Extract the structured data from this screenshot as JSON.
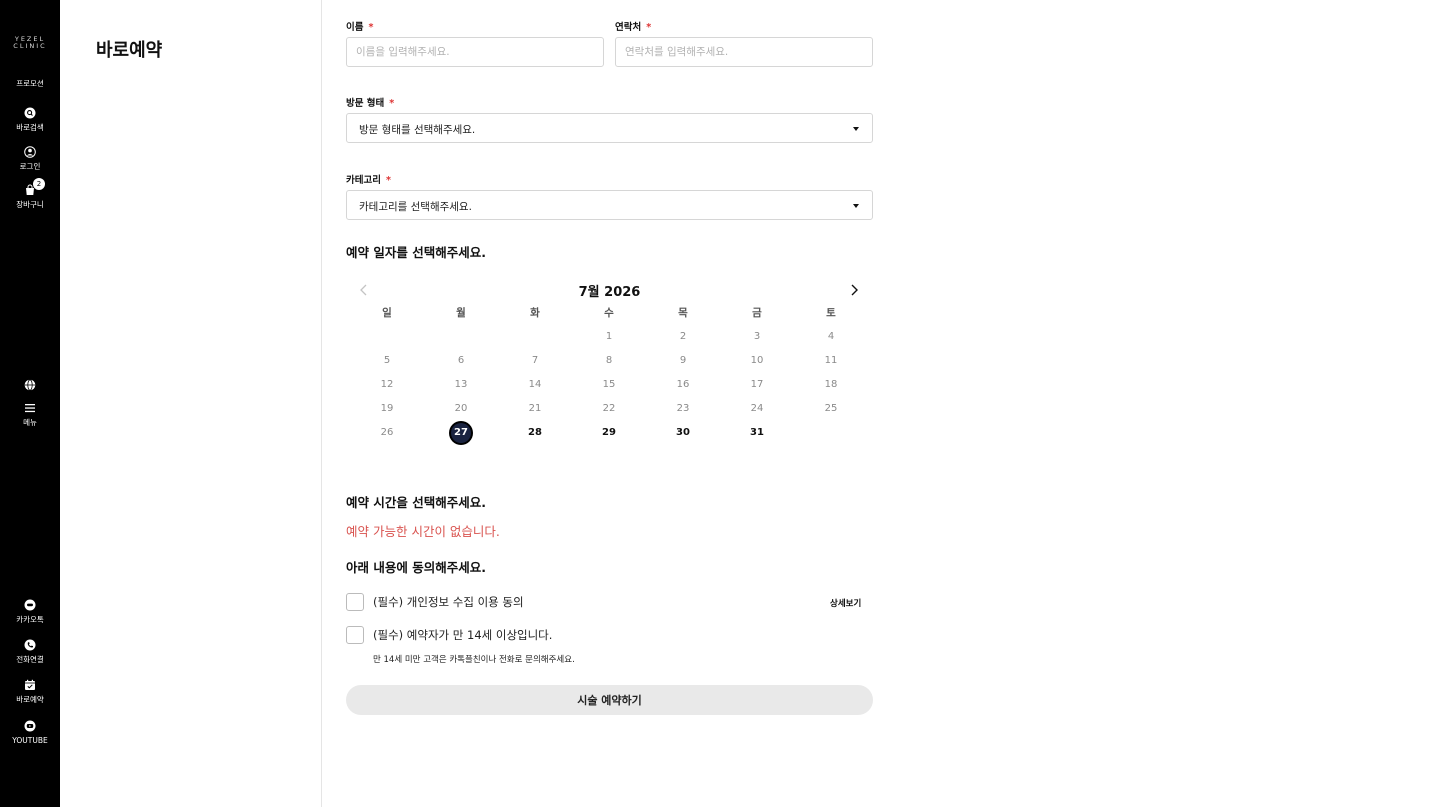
{
  "sidebar": {
    "logo_line1": "YEZEL",
    "logo_line2": "CLINIC",
    "items_top": [
      {
        "label": "프로모션",
        "icon": "none"
      },
      {
        "label": "바로검색",
        "icon": "search-icon"
      },
      {
        "label": "로그인",
        "icon": "user-icon"
      },
      {
        "label": "장바구니",
        "icon": "cart-icon",
        "badge": "2"
      }
    ],
    "items_mid": [
      {
        "label": "",
        "icon": "globe-icon"
      },
      {
        "label": "메뉴",
        "icon": "menu-icon"
      }
    ],
    "items_bottom": [
      {
        "label": "카카오톡",
        "icon": "kakaotalk-icon"
      },
      {
        "label": "전화연결",
        "icon": "phone-icon"
      },
      {
        "label": "바로예약",
        "icon": "calendar-check-icon"
      },
      {
        "label": "YOUTUBE",
        "icon": "youtube-icon"
      }
    ]
  },
  "page": {
    "title": "바로예약"
  },
  "form": {
    "name": {
      "label": "이름",
      "required": "*",
      "placeholder": "이름을 입력해주세요.",
      "value": ""
    },
    "contact": {
      "label": "연락처",
      "required": "*",
      "placeholder": "연락처를 입력해주세요.",
      "value": ""
    },
    "visit_type": {
      "label": "방문 형태",
      "required": "*",
      "selected": "방문 형태를 선택해주세요."
    },
    "category": {
      "label": "카테고리",
      "required": "*",
      "selected": "카테고리를 선택해주세요."
    }
  },
  "calendar": {
    "section_title": "예약 일자를 선택해주세요.",
    "month_label": "7월 2026",
    "weekdays": [
      "일",
      "월",
      "화",
      "수",
      "목",
      "금",
      "토"
    ],
    "weeks": [
      [
        "",
        "",
        "",
        "1",
        "2",
        "3",
        "4"
      ],
      [
        "5",
        "6",
        "7",
        "8",
        "9",
        "10",
        "11"
      ],
      [
        "12",
        "13",
        "14",
        "15",
        "16",
        "17",
        "18"
      ],
      [
        "19",
        "20",
        "21",
        "22",
        "23",
        "24",
        "25"
      ],
      [
        "26",
        "27",
        "28",
        "29",
        "30",
        "31",
        ""
      ]
    ],
    "selected_day": "27",
    "available_days": [
      "27",
      "28",
      "29",
      "30",
      "31"
    ]
  },
  "time": {
    "section_title": "예약 시간을 선택해주세요.",
    "empty_message": "예약 가능한 시간이 없습니다."
  },
  "agreement": {
    "section_title": "아래 내용에 동의해주세요.",
    "privacy_label": "(필수) 개인정보 수집 이용 동의",
    "detail_link": "상세보기",
    "age_label": "(필수) 예약자가 만 14세 이상입니다.",
    "age_note": "만 14세 미만 고객은 카톡플친이나 전화로 문의해주세요."
  },
  "submit": {
    "label": "시술 예약하기"
  },
  "colors": {
    "sidebar_bg": "#000000",
    "required": "#dd3333",
    "error_text": "#d9534f",
    "selected_day_bg": "#1a2340",
    "submit_bg": "#e9e9e9"
  }
}
